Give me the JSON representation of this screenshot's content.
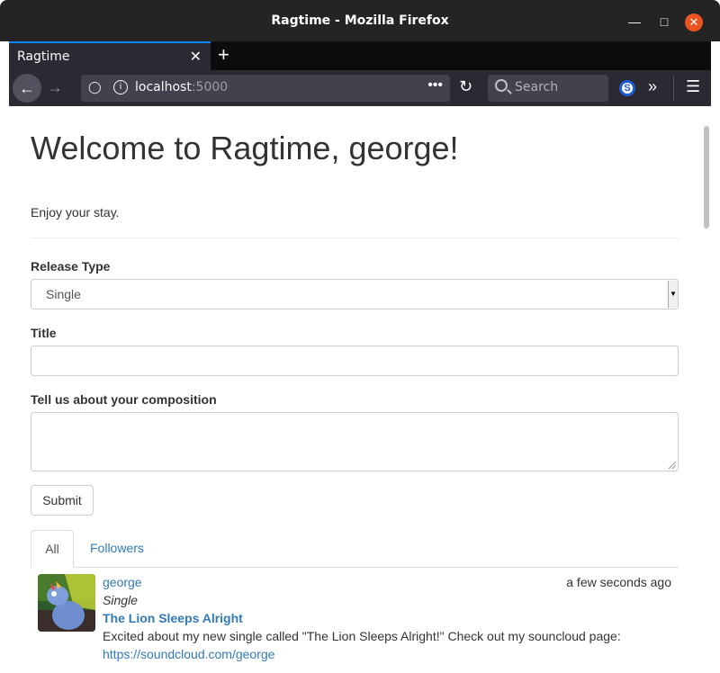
{
  "window": {
    "title": "Ragtime - Mozilla Firefox",
    "minimize_icon": "minimize-icon",
    "maximize_icon": "maximize-icon",
    "close_icon": "close-icon"
  },
  "browser": {
    "tab_title": "Ragtime",
    "url_host": "localhost",
    "url_port": ":5000",
    "search_placeholder": "Search",
    "extension_letter": "S"
  },
  "page": {
    "heading": "Welcome to Ragtime, george!",
    "lead": "Enjoy your stay.",
    "form": {
      "release_type_label": "Release Type",
      "release_type_value": "Single",
      "title_label": "Title",
      "title_value": "",
      "composition_label": "Tell us about your composition",
      "composition_value": "",
      "submit_label": "Submit"
    },
    "tabs": [
      {
        "label": "All",
        "active": true
      },
      {
        "label": "Followers",
        "active": false
      }
    ],
    "posts": [
      {
        "author": "george",
        "time": "a few seconds ago",
        "release_type": "Single",
        "title": "The Lion Sleeps Alright",
        "body": "Excited about my new single called \"The Lion Sleeps Alright!\" Check out my souncloud page:",
        "link": "https://soundcloud.com/george"
      }
    ]
  },
  "colors": {
    "link": "#337ab7",
    "text": "#333333",
    "chrome_dark": "#2b2a33",
    "close_button": "#e95420"
  }
}
